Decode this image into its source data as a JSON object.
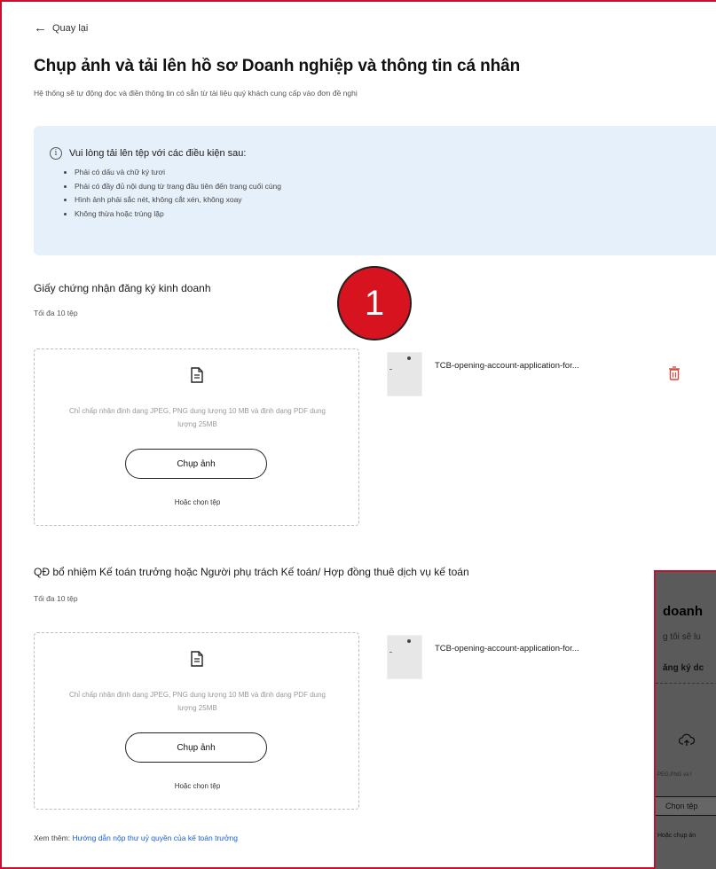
{
  "nav": {
    "back_label": "Quay lại"
  },
  "header": {
    "title": "Chụp ảnh và tải lên hồ sơ Doanh nghiệp và thông tin cá nhân",
    "subtitle": "Hệ thống sẽ tự động đọc và điền thông tin có sẵn từ tài liệu quý khách cung cấp vào đơn đề nghị"
  },
  "notice": {
    "heading": "Vui lòng tải lên tệp với các điều kiện sau:",
    "items": [
      "Phải có dấu và chữ ký tươi",
      "Phải có đầy đủ nội dung từ trang đầu tiên đến trang cuối cùng",
      "Hình ảnh phải sắc nét, không cắt xén, không xoay",
      "Không thừa hoặc trùng lặp"
    ]
  },
  "badge": {
    "label": "1",
    "color": "#d7131f"
  },
  "sections": [
    {
      "title": "Giấy chứng nhận đăng ký kinh doanh",
      "limit": "Tối đa 10 tệp",
      "dropzone": {
        "hint": "Chỉ chấp nhận định dạng JPEG, PNG dung lượng 10 MB và định dạng PDF dung lượng 25MB",
        "button": "Chụp ảnh",
        "alt_link": "Hoặc chọn tệp"
      },
      "file_name": "TCB-opening-account-application-for..."
    },
    {
      "title": "QĐ bổ nhiệm Kế toán trưởng hoặc Người phụ trách Kế toán/ Hợp đồng thuê dịch vụ kế toán",
      "limit": "Tối đa 10 tệp",
      "dropzone": {
        "hint": "Chỉ chấp nhận định dạng JPEG, PNG dung lượng 10 MB và định dạng PDF dung lượng 25MB",
        "button": "Chụp ảnh",
        "alt_link": "Hoặc chọn tệp"
      },
      "file_name": "TCB-opening-account-application-for..."
    }
  ],
  "footer": {
    "more_prefix": "Xem thêm:",
    "more_link": "Hướng dẫn nộp thư uỷ quyền của kế toán trưởng"
  },
  "overlay": {
    "title": "doanh",
    "subtitle": "g tôi sẽ lu",
    "label": "ăng ký dc",
    "hint": "PEG,PNG và I",
    "button": "Chọn tệp",
    "alt": "Hoặc chụp ản"
  },
  "colors": {
    "accent": "#c8102e",
    "link": "#1a5fd1",
    "info_bg": "#e6f0fb",
    "delete": "#e0463a"
  }
}
